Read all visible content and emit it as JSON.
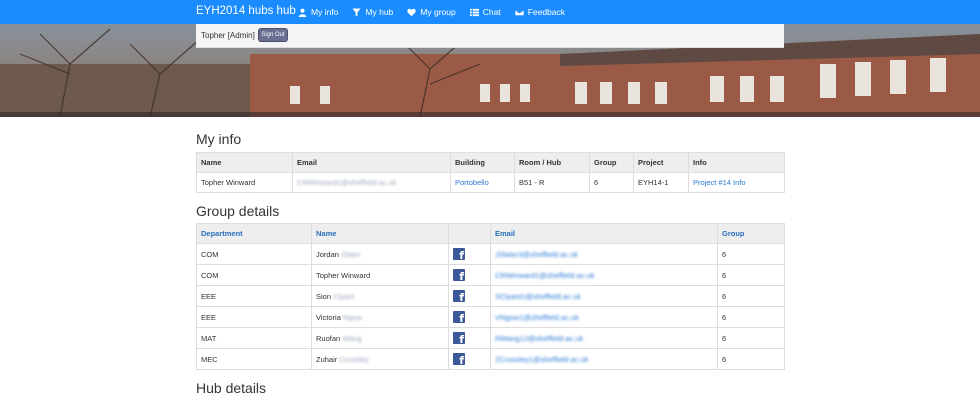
{
  "navbar": {
    "brand": "EYH2014 hubs hub",
    "items": [
      {
        "label": "My info",
        "icon": "user-icon"
      },
      {
        "label": "My hub",
        "icon": "filter-icon"
      },
      {
        "label": "My group",
        "icon": "heart-icon"
      },
      {
        "label": "Chat",
        "icon": "list-icon"
      },
      {
        "label": "Feedback",
        "icon": "envelope-icon"
      }
    ]
  },
  "userbar": {
    "username": "Topher [Admin]",
    "signout_label": "Sign Out"
  },
  "my_info": {
    "heading": "My info",
    "columns": [
      "Name",
      "Email",
      "Building",
      "Room / Hub",
      "Group",
      "Project",
      "Info"
    ],
    "row": {
      "name": "Topher Winward",
      "email": "CRWinward1@sheffield.ac.uk",
      "building": "Portobello",
      "room": "B51 - R",
      "group": "6",
      "project": "EYH14-1",
      "info": "Project #14 Info"
    }
  },
  "group_details": {
    "heading": "Group details",
    "columns": [
      "Department",
      "Name",
      "",
      "Email",
      "Group"
    ],
    "rows": [
      {
        "department": "COM",
        "first": "Jordan",
        "last": "Slater",
        "email": "JSlater3@sheffield.ac.uk",
        "group": "6"
      },
      {
        "department": "COM",
        "first": "Topher Winward",
        "last": "",
        "email": "CRWinward1@sheffield.ac.uk",
        "group": "6"
      },
      {
        "department": "EEE",
        "first": "Sion",
        "last": "Clyant",
        "email": "SClyant1@sheffield.ac.uk",
        "group": "6"
      },
      {
        "department": "EEE",
        "first": "Victoria",
        "last": "Ngow",
        "email": "VNgow1@sheffield.ac.uk",
        "group": "6"
      },
      {
        "department": "MAT",
        "first": "Ruofan",
        "last": "Wang",
        "email": "RWang12@sheffield.ac.uk",
        "group": "6"
      },
      {
        "department": "MEC",
        "first": "Zuhair",
        "last": "Crossley",
        "email": "ZCrossley1@sheffield.ac.uk",
        "group": "6"
      }
    ]
  },
  "hub_details": {
    "heading": "Hub details"
  }
}
